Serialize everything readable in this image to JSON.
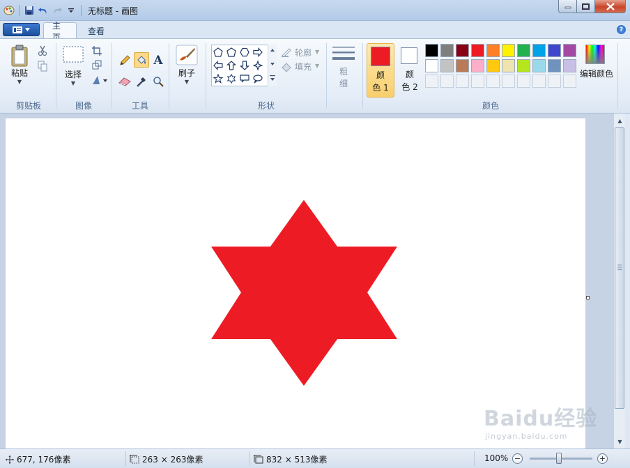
{
  "window": {
    "title": "无标题 - 画图"
  },
  "tabs": [
    {
      "label": "主页"
    },
    {
      "label": "查看"
    }
  ],
  "ribbon": {
    "clipboard": {
      "paste_label": "粘贴",
      "group_label": "剪贴板"
    },
    "image": {
      "select_label": "选择",
      "group_label": "图像"
    },
    "tools": {
      "group_label": "工具"
    },
    "brushes": {
      "label": "刷子"
    },
    "shapes": {
      "outline_label": "轮廓",
      "fill_label": "填充",
      "group_label": "形状"
    },
    "size": {
      "label_line1": "粗",
      "label_line2": "细"
    },
    "colors": {
      "color1_line1": "颜",
      "color1_line2": "色 1",
      "color2_line1": "颜",
      "color2_line2": "色 2",
      "color1_value": "#ed1c24",
      "color2_value": "#ffffff",
      "edit_label": "编辑颜色",
      "group_label": "颜色",
      "palette_row1": [
        "#000000",
        "#7f7f7f",
        "#880015",
        "#ed1c24",
        "#ff7f27",
        "#fff200",
        "#22b14c",
        "#00a2e8",
        "#3f48cc",
        "#a349a4"
      ],
      "palette_row2": [
        "#ffffff",
        "#c3c3c3",
        "#b97a57",
        "#ffaec9",
        "#ffc90e",
        "#efe4b0",
        "#b5e61d",
        "#99d9ea",
        "#7092be",
        "#c8bfe7"
      ]
    }
  },
  "canvas": {
    "shape": "six-pointed-star",
    "fill_color": "#ed1c24"
  },
  "status": {
    "cursor_pos": "677, 176像素",
    "selection_size": "263 × 263像素",
    "canvas_size": "832 × 513像素",
    "zoom": "100%"
  },
  "watermark": {
    "logo": "Baidu经验",
    "sub": "jingyan.baidu.com"
  }
}
